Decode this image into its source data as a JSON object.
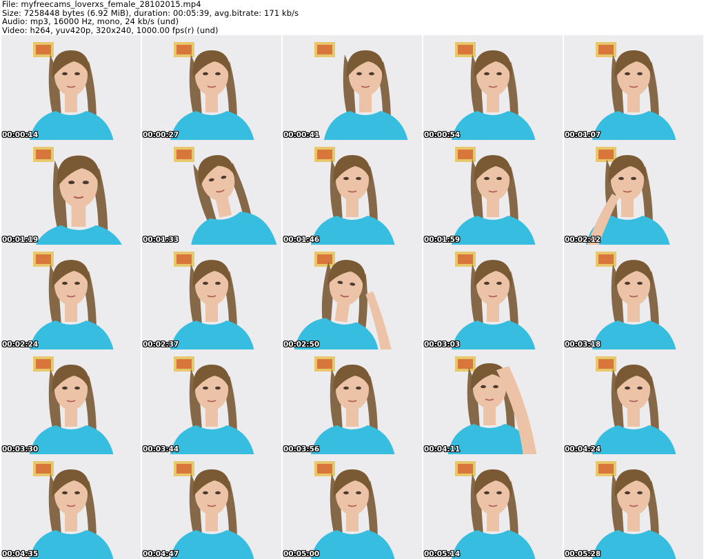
{
  "header": {
    "file_line": "File: myfreecams_loverxs_female_28102015.mp4",
    "size_line": "Size: 7258448 bytes (6.92 MiB), duration: 00:05:39, avg.bitrate: 171 kb/s",
    "audio_line": "Audio: mp3, 16000 Hz, mono, 24 kb/s (und)",
    "video_line": "Video: h264, yuv420p, 320x240, 1000.00 fps(r) (und)"
  },
  "colors": {
    "background": "#ffffff",
    "wall": "#ececee",
    "shirt": "#37bde0",
    "skin": "#ecc3a6",
    "hair": "#7a5a35",
    "frame": "#e7c86a"
  },
  "thumbnails": [
    {
      "timestamp": "00:00:14",
      "pose": "center"
    },
    {
      "timestamp": "00:00:27",
      "pose": "center"
    },
    {
      "timestamp": "00:00:41",
      "pose": "right"
    },
    {
      "timestamp": "00:00:54",
      "pose": "center"
    },
    {
      "timestamp": "00:01:07",
      "pose": "center"
    },
    {
      "timestamp": "00:01:19",
      "pose": "close"
    },
    {
      "timestamp": "00:01:33",
      "pose": "turned"
    },
    {
      "timestamp": "00:01:46",
      "pose": "center"
    },
    {
      "timestamp": "00:01:59",
      "pose": "center"
    },
    {
      "timestamp": "00:02:12",
      "pose": "hand-neck"
    },
    {
      "timestamp": "00:02:24",
      "pose": "center"
    },
    {
      "timestamp": "00:02:37",
      "pose": "center"
    },
    {
      "timestamp": "00:02:50",
      "pose": "hand-hair"
    },
    {
      "timestamp": "00:03:03",
      "pose": "center"
    },
    {
      "timestamp": "00:03:18",
      "pose": "center"
    },
    {
      "timestamp": "00:03:30",
      "pose": "center"
    },
    {
      "timestamp": "00:03:44",
      "pose": "center"
    },
    {
      "timestamp": "00:03:56",
      "pose": "center"
    },
    {
      "timestamp": "00:04:11",
      "pose": "hand-face"
    },
    {
      "timestamp": "00:04:24",
      "pose": "center"
    },
    {
      "timestamp": "00:04:35",
      "pose": "center"
    },
    {
      "timestamp": "00:04:47",
      "pose": "center"
    },
    {
      "timestamp": "00:05:00",
      "pose": "center"
    },
    {
      "timestamp": "00:05:14",
      "pose": "center"
    },
    {
      "timestamp": "00:05:28",
      "pose": "center"
    }
  ]
}
